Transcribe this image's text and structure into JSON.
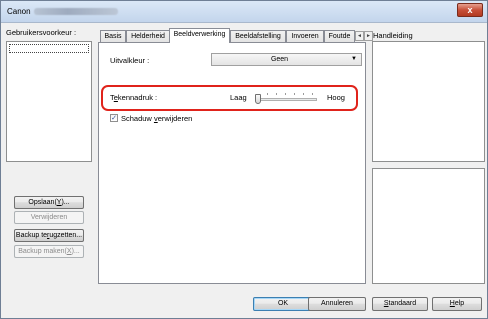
{
  "window": {
    "title": "Canon",
    "close_label": "x"
  },
  "left": {
    "prefs_label": "Gebruikersvoorkeur :",
    "buttons": {
      "save": "Opslaan(Y)...",
      "delete": "Verwijderen",
      "restore_backup": "Backup terugzetten...",
      "make_backup": "Backup maken(X)..."
    }
  },
  "tabs": [
    "Basis",
    "Helderheid",
    "Beeldverwerking",
    "Beeldafstelling",
    "Invoeren",
    "Foutde"
  ],
  "active_tab": "Beeldverwerking",
  "tab_scroll": {
    "left": "◄",
    "right": "►"
  },
  "content": {
    "color_drop_label": "Uitvalkleur :",
    "color_drop_value": "Geen",
    "text_emphasis_label": "Tekennadruk :",
    "slider_low": "Laag",
    "slider_high": "Hoog",
    "slider_value": 0,
    "shadow_checkbox_label": "Schaduw verwijderen",
    "shadow_checked": true
  },
  "help_panel": {
    "title": "Handleiding"
  },
  "footer": {
    "ok": "OK",
    "cancel": "Annuleren",
    "default": "Standaard",
    "help": "Help"
  },
  "colors": {
    "highlight": "#e0231b",
    "title_gradient_top": "#dbe8f7",
    "close_red": "#c75039"
  }
}
